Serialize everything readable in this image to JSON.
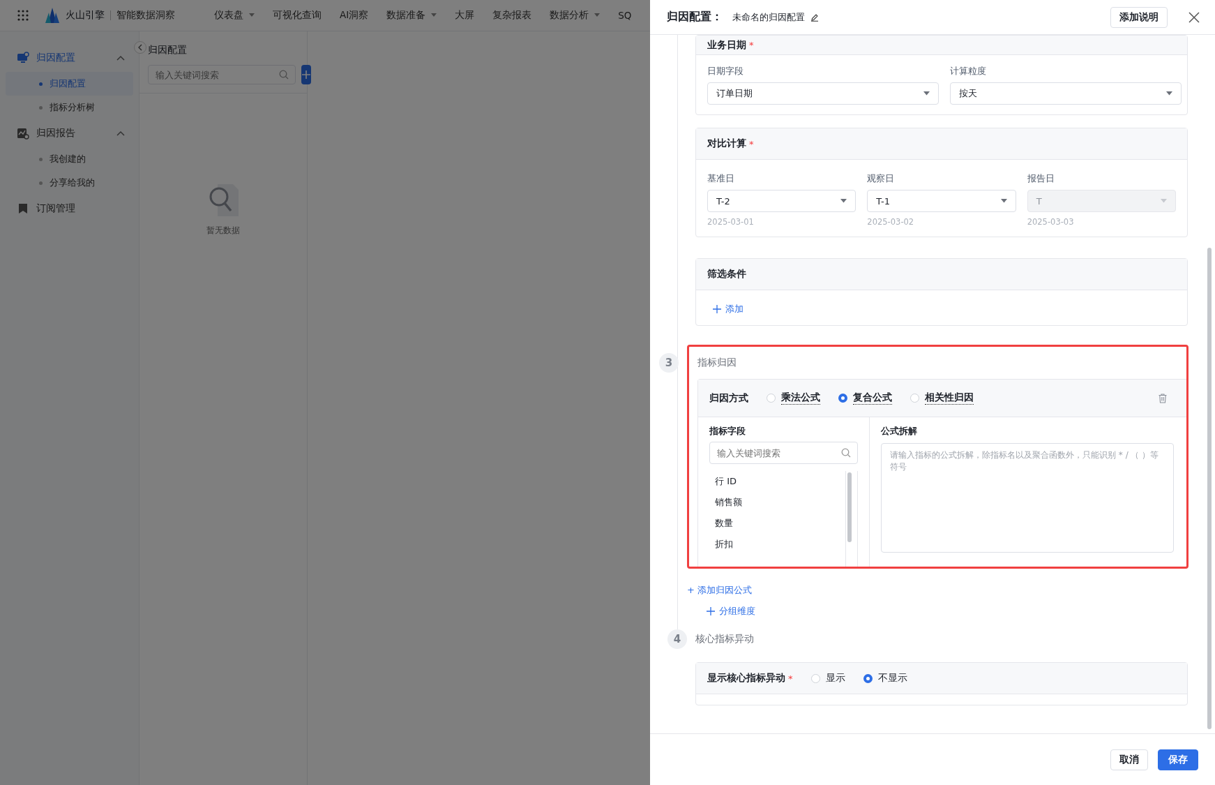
{
  "top_bar": {
    "brand": "火山引擎",
    "product": "智能数据洞察",
    "nav": [
      {
        "label": "仪表盘",
        "dropdown": true
      },
      {
        "label": "可视化查询",
        "dropdown": false
      },
      {
        "label": "AI洞察",
        "dropdown": false
      },
      {
        "label": "数据准备",
        "dropdown": true
      },
      {
        "label": "大屏",
        "dropdown": false
      },
      {
        "label": "复杂报表",
        "dropdown": false
      },
      {
        "label": "数据分析",
        "dropdown": true
      },
      {
        "label": "SQ",
        "dropdown": false
      }
    ]
  },
  "sidebar": {
    "groups": [
      {
        "label": "归因配置",
        "kind": "monitor",
        "expanded": true,
        "active": true,
        "children": [
          {
            "label": "归因配置",
            "selected": true
          },
          {
            "label": "指标分析树",
            "selected": false
          }
        ]
      },
      {
        "label": "归因报告",
        "kind": "report",
        "expanded": true,
        "active": false,
        "children": [
          {
            "label": "我创建的",
            "selected": false
          },
          {
            "label": "分享给我的",
            "selected": false
          }
        ]
      },
      {
        "label": "订阅管理",
        "kind": "bookmark",
        "active": false
      }
    ]
  },
  "list_panel": {
    "title": "归因配置",
    "search_placeholder": "输入关键词搜索",
    "empty_text": "暂无数据"
  },
  "drawer": {
    "title": "归因配置：",
    "name": "未命名的归因配置",
    "add_note_button": "添加说明",
    "cards": [
      {
        "title": "业务日期",
        "required_mark": "*",
        "fields": [
          {
            "label": "日期字段",
            "value": "订单日期",
            "disabled": false
          },
          {
            "label": "计算粒度",
            "value": "按天",
            "disabled": false
          }
        ]
      },
      {
        "title": "对比计算",
        "required_mark": "*",
        "fields": [
          {
            "label": "基准日",
            "value": "T-2",
            "hint": "2025-03-01",
            "disabled": false
          },
          {
            "label": "观察日",
            "value": "T-1",
            "hint": "2025-03-02",
            "disabled": false
          },
          {
            "label": "报告日",
            "value": "T",
            "hint": "2025-03-03",
            "disabled": true
          }
        ]
      },
      {
        "title": "筛选条件",
        "add_link": "添加"
      }
    ],
    "attribution_step": {
      "number": "3",
      "title": "指标归因",
      "highlighted": true,
      "method_label": "归因方式",
      "methods": [
        {
          "label": "乘法公式",
          "selected": false
        },
        {
          "label": "复合公式",
          "selected": true
        },
        {
          "label": "相关性归因",
          "selected": false
        }
      ],
      "field_title": "指标字段",
      "field_search_placeholder": "输入关键词搜索",
      "fields": [
        "行 ID",
        "销售额",
        "数量",
        "折扣"
      ],
      "formula_title": "公式拆解",
      "formula_placeholder": "请输入指标的公式拆解，除指标名以及聚合函数外，只能识别 * / （ ）等符号"
    },
    "add_formula_link": "+ 添加归因公式",
    "group_dimension_link": "分组维度",
    "anomaly_step": {
      "number": "4",
      "title": "核心指标异动",
      "label": "显示核心指标异动",
      "required_mark": "*",
      "options": [
        {
          "label": "显示",
          "selected": false
        },
        {
          "label": "不显示",
          "selected": true
        }
      ]
    },
    "footer_buttons": [
      {
        "label": "取消",
        "primary": false
      },
      {
        "label": "保存",
        "primary": true
      }
    ]
  }
}
